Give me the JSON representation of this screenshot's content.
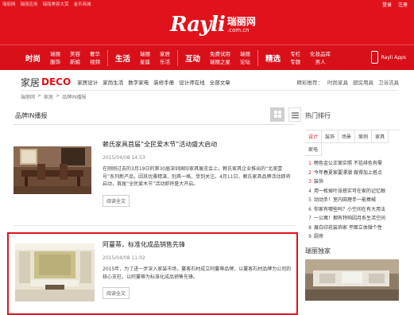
{
  "topbar": {
    "links": [
      "瑞丽网",
      "瑞丽应用",
      "瑞丽美容大赏",
      "金币商城"
    ],
    "account": [
      "登录",
      "注册"
    ],
    "logo_en": "Rayli",
    "logo_cn": "瑞丽网",
    "logo_domain": ".com.cn"
  },
  "nav": {
    "groups": [
      {
        "big": "时尚",
        "pairs": [
          [
            "瑞丽",
            "服饰"
          ],
          [
            "美容",
            "新娘"
          ],
          [
            "奢华",
            "视频"
          ]
        ]
      },
      {
        "big": "生活",
        "pairs": [
          [
            "瑞丽",
            "星座"
          ],
          [
            "家居",
            "乐活"
          ]
        ]
      },
      {
        "big": "互动",
        "pairs": [
          [
            "免费试用",
            "瑞丽之星"
          ],
          [
            "瑞丽",
            "论坛"
          ]
        ]
      },
      {
        "big": "精选",
        "pairs": [
          [
            "专栏",
            "专题"
          ],
          [
            "化妆品库",
            "男人"
          ]
        ]
      }
    ],
    "apps_label": "Rayli Apps"
  },
  "section": {
    "title_cn": "家居",
    "title_en": "DECO",
    "sublinks": [
      "家居设计",
      "家尚生活",
      "数字家电",
      "装修手册",
      "设计师在线",
      "全部文章"
    ],
    "recommend_label": "精彩推荐：",
    "recommend": [
      "时尚家具",
      "厨房用具",
      "卫浴洁具"
    ]
  },
  "breadcrumb": [
    "瑞丽网",
    ">",
    "家居",
    ">",
    "品牌IN播报"
  ],
  "list": {
    "label": "品牌IN播报"
  },
  "articles": [
    {
      "title": "赖氏家具首届“全民爱木节”活动盛大启动",
      "date": "2015/04/08 14:53",
      "summary": "在刚刚过去的3月19日的第30届深圳国际家具展览会上，赖氏家具企业推出的“北美壹号”系列新产品，因其优雅精湛、别具一格，受到关注。4月11日，赖氏家具品牌活动即将启动，首届“全民爱木节”活动即将盛大开启。",
      "read_more": "阅读全文"
    },
    {
      "title": "阿蔓蒂，标准化成品销售先锋",
      "date": "2015/04/08 11:02",
      "summary": "2015年，为了进一步深入家装市场，蔓客石材成立阿蔓蒂品牌，以蔓客石材品牌为公司的核心支柱，以阿蔓蒂为标准化成品销售先锋。",
      "read_more": "阅读全文"
    }
  ],
  "sidebar": {
    "hot_title": "热门排行",
    "tabs": [
      "设计",
      "装饰",
      "场景",
      "案例",
      "家具",
      "家电"
    ],
    "ranks": [
      {
        "n": "1",
        "text": "畅色金公正案实照 不括排色有需"
      },
      {
        "n": "2",
        "text": "今年春夏家要漂潮 做得加上搭点"
      },
      {
        "n": "3",
        "text": "装饰"
      },
      {
        "n": "4",
        "text": "用一枚掉叶张搭实可在家的记忆眼"
      },
      {
        "n": "5",
        "text": "动动手！室内田理手一能棒械"
      },
      {
        "n": "6",
        "text": "你家有哪些吗？小空间在有大用法"
      },
      {
        "n": "7",
        "text": "一公寓！拥有特响因月系生活空间"
      },
      {
        "n": "8",
        "text": "展白印花装饰家 平面立体微个性"
      },
      {
        "n": "9",
        "text": "厨房"
      }
    ],
    "exclusive_title": "瑞丽独家"
  }
}
